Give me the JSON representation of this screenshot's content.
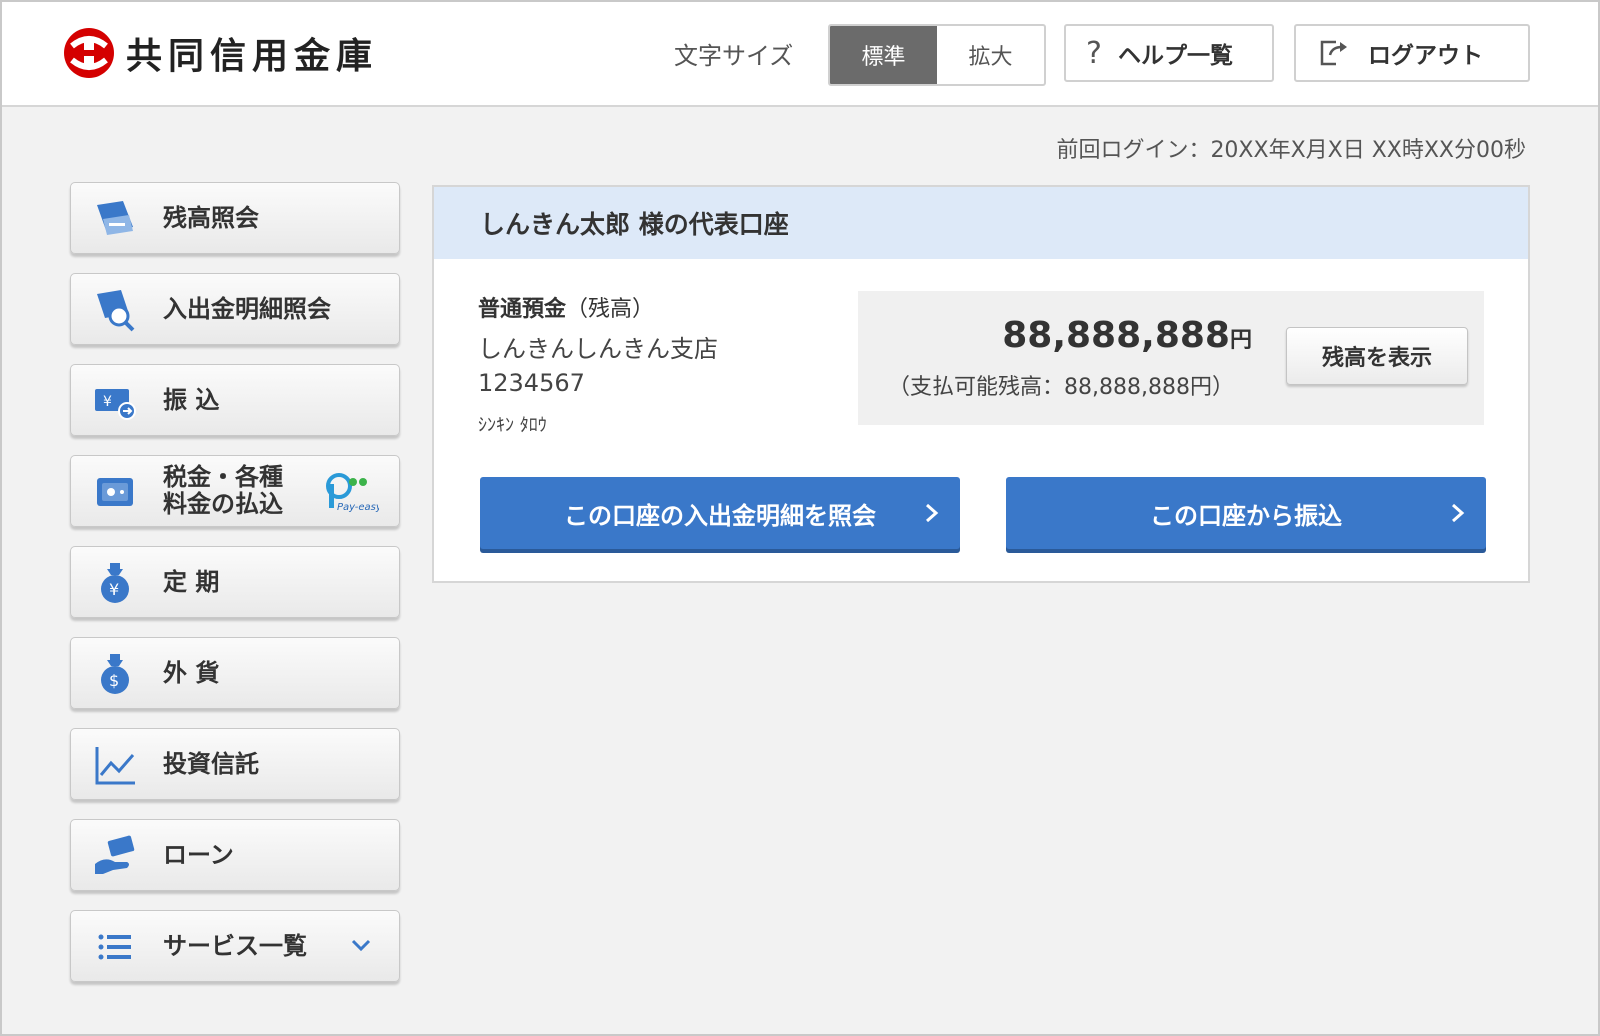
{
  "header": {
    "bank_name": "共同信用金庫",
    "font_size_label": "文字サイズ",
    "font_size_options": [
      "標準",
      "拡大"
    ],
    "font_size_selected": "標準",
    "help_label": "ヘルプ一覧",
    "logout_label": "ログアウト"
  },
  "last_login": "前回ログイン：20XX年X月X日 XX時XX分00秒",
  "sidebar": {
    "items": [
      {
        "label": "残高照会",
        "icon": "balance-card-icon"
      },
      {
        "label": "入出金明細照会",
        "icon": "statement-search-icon"
      },
      {
        "label": "振 込",
        "icon": "transfer-icon"
      },
      {
        "label": "税金・各種\n料金の払込",
        "icon": "safe-icon",
        "badge": "Pay-easy"
      },
      {
        "label": "定 期",
        "icon": "yen-bag-icon"
      },
      {
        "label": "外 貨",
        "icon": "dollar-bag-icon"
      },
      {
        "label": "投資信託",
        "icon": "line-chart-icon"
      },
      {
        "label": "ローン",
        "icon": "loan-hand-icon"
      },
      {
        "label": "サービス一覧",
        "icon": "list-icon"
      }
    ]
  },
  "account": {
    "title": "しんきん太郎 様の代表口座",
    "type": "普通預金",
    "type_note": "（残高）",
    "branch": "しんきんしんきん支店",
    "number": "1234567",
    "holder_kana": "ｼﾝｷﾝ ﾀﾛｳ",
    "balance": "88,888,888",
    "currency": "円",
    "available": "（支払可能残高：88,888,888円）",
    "show_balance_label": "残高を表示",
    "statement_button": "この口座の入出金明細を照会",
    "transfer_button": "この口座から振込"
  },
  "colors": {
    "primary_button": "#3a78c9",
    "panel_header": "#dde9f8",
    "logo_red": "#d40000",
    "active_toggle": "#6b6b6b"
  }
}
